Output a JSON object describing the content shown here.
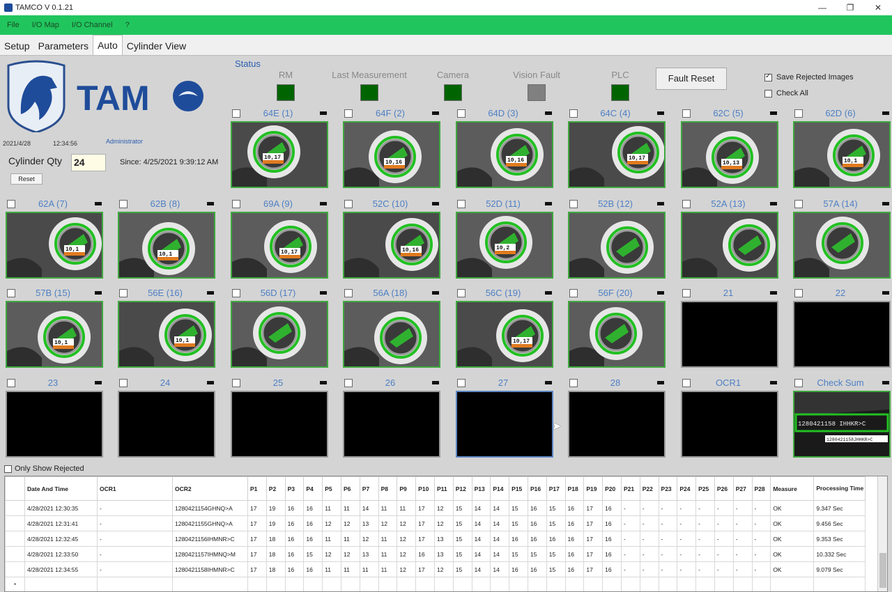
{
  "window": {
    "title": "TAMCO V 0.1.21",
    "min": "—",
    "max": "❐",
    "close": "✕"
  },
  "menu": [
    "File",
    "I/O Map",
    "I/O Channel",
    "?"
  ],
  "tabs": [
    {
      "label": "Setup",
      "active": false
    },
    {
      "label": "Parameters",
      "active": false
    },
    {
      "label": "Auto",
      "active": true
    },
    {
      "label": "Cylinder View",
      "active": false
    }
  ],
  "logo": {
    "text": "TAM"
  },
  "info": {
    "date": "2021/4/28",
    "time": "12:34:56",
    "user": "Administrator"
  },
  "cylinder": {
    "label": "Cylinder Qty",
    "value": "24",
    "since": "Since: 4/25/2021 9:39:12 AM",
    "reset": "Reset"
  },
  "status": {
    "title": "Status",
    "items": [
      {
        "label": "RM",
        "color": "#006400"
      },
      {
        "label": "Last Measurement",
        "color": "#006400"
      },
      {
        "label": "Camera",
        "color": "#006400"
      },
      {
        "label": "Vision Fault",
        "color": "#808080"
      },
      {
        "label": "PLC",
        "color": "#006400"
      }
    ],
    "fault_reset": "Fault Reset"
  },
  "options": {
    "save_rejected": "Save Rejected Images",
    "check_all": "Check All",
    "only_rejected": "Only Show Rejected"
  },
  "cameras": [
    {
      "label": "64E (1)",
      "state": "ok",
      "reading": "10,17"
    },
    {
      "label": "64F (2)",
      "state": "ok",
      "reading": "10,16"
    },
    {
      "label": "64D (3)",
      "state": "ok",
      "reading": "10,16"
    },
    {
      "label": "64C (4)",
      "state": "ok",
      "reading": "10,17"
    },
    {
      "label": "62C (5)",
      "state": "ok",
      "reading": "10,13"
    },
    {
      "label": "62D (6)",
      "state": "ok",
      "reading": "10,1"
    },
    {
      "label": "62A (7)",
      "state": "ok",
      "reading": "10,1"
    },
    {
      "label": "62B (8)",
      "state": "ok",
      "reading": "10,1"
    },
    {
      "label": "69A (9)",
      "state": "ok",
      "reading": "10,17"
    },
    {
      "label": "52C (10)",
      "state": "ok",
      "reading": "10,16"
    },
    {
      "label": "52D (11)",
      "state": "ok",
      "reading": "10,2"
    },
    {
      "label": "52B (12)",
      "state": "ok",
      "reading": ""
    },
    {
      "label": "52A (13)",
      "state": "ok",
      "reading": ""
    },
    {
      "label": "57A (14)",
      "state": "ok",
      "reading": ""
    },
    {
      "label": "57B (15)",
      "state": "ok",
      "reading": "10,1"
    },
    {
      "label": "56E (16)",
      "state": "ok",
      "reading": "10,1"
    },
    {
      "label": "56D (17)",
      "state": "ok",
      "reading": ""
    },
    {
      "label": "56A (18)",
      "state": "ok",
      "reading": ""
    },
    {
      "label": "56C (19)",
      "state": "ok",
      "reading": "10,17"
    },
    {
      "label": "56F (20)",
      "state": "ok",
      "reading": ""
    },
    {
      "label": "21",
      "state": "empty",
      "reading": ""
    },
    {
      "label": "22",
      "state": "empty",
      "reading": ""
    },
    {
      "label": "23",
      "state": "empty",
      "reading": ""
    },
    {
      "label": "24",
      "state": "empty",
      "reading": ""
    },
    {
      "label": "25",
      "state": "empty",
      "reading": ""
    },
    {
      "label": "26",
      "state": "empty",
      "reading": ""
    },
    {
      "label": "27",
      "state": "selected",
      "reading": ""
    },
    {
      "label": "28",
      "state": "empty",
      "reading": ""
    },
    {
      "label": "OCR1",
      "state": "empty",
      "reading": ""
    },
    {
      "label": "Check Sum",
      "state": "checksum",
      "reading": "1280421158 IHHKR>C"
    }
  ],
  "checksum_small": "1280421158JHHKR>C",
  "table": {
    "headers": [
      "Date And Time",
      "OCR1",
      "OCR2",
      "P1",
      "P2",
      "P3",
      "P4",
      "P5",
      "P6",
      "P7",
      "P8",
      "P9",
      "P10",
      "P11",
      "P12",
      "P13",
      "P14",
      "P15",
      "P16",
      "P17",
      "P18",
      "P19",
      "P20",
      "P21",
      "P22",
      "P23",
      "P24",
      "P25",
      "P26",
      "P27",
      "P28",
      "Measure",
      "Processing Time"
    ],
    "rows": [
      [
        "4/28/2021 12:30:35",
        "-",
        "1280421154GHNQ>A",
        "17",
        "19",
        "16",
        "16",
        "11",
        "11",
        "14",
        "11",
        "11",
        "17",
        "12",
        "15",
        "14",
        "14",
        "15",
        "16",
        "15",
        "16",
        "17",
        "16",
        "-",
        "-",
        "-",
        "-",
        "-",
        "-",
        "-",
        "-",
        "OK",
        "9.347 Sec"
      ],
      [
        "4/28/2021 12:31:41",
        "-",
        "1280421155GHNQ>A",
        "17",
        "19",
        "16",
        "16",
        "12",
        "12",
        "13",
        "12",
        "12",
        "17",
        "12",
        "15",
        "14",
        "14",
        "15",
        "16",
        "15",
        "16",
        "17",
        "16",
        "-",
        "-",
        "-",
        "-",
        "-",
        "-",
        "-",
        "-",
        "OK",
        "9.456 Sec"
      ],
      [
        "4/28/2021 12:32:45",
        "-",
        "1280421156IHMNR>C",
        "17",
        "18",
        "16",
        "16",
        "11",
        "11",
        "12",
        "11",
        "12",
        "17",
        "13",
        "15",
        "14",
        "14",
        "16",
        "16",
        "16",
        "16",
        "17",
        "16",
        "-",
        "-",
        "-",
        "-",
        "-",
        "-",
        "-",
        "-",
        "OK",
        "9.353 Sec"
      ],
      [
        "4/28/2021 12:33:50",
        "-",
        "1280421157IHMNQ>M",
        "17",
        "18",
        "16",
        "15",
        "12",
        "12",
        "13",
        "11",
        "12",
        "16",
        "13",
        "15",
        "14",
        "14",
        "15",
        "15",
        "15",
        "16",
        "17",
        "16",
        "-",
        "-",
        "-",
        "-",
        "-",
        "-",
        "-",
        "-",
        "OK",
        "10.332 Sec"
      ],
      [
        "4/28/2021 12:34:55",
        "-",
        "1280421158IHMNR>C",
        "17",
        "18",
        "16",
        "16",
        "11",
        "11",
        "11",
        "11",
        "12",
        "17",
        "12",
        "15",
        "14",
        "14",
        "16",
        "16",
        "15",
        "16",
        "17",
        "16",
        "-",
        "-",
        "-",
        "-",
        "-",
        "-",
        "-",
        "-",
        "OK",
        "9.079 Sec"
      ]
    ],
    "new_row_marker": "*"
  }
}
